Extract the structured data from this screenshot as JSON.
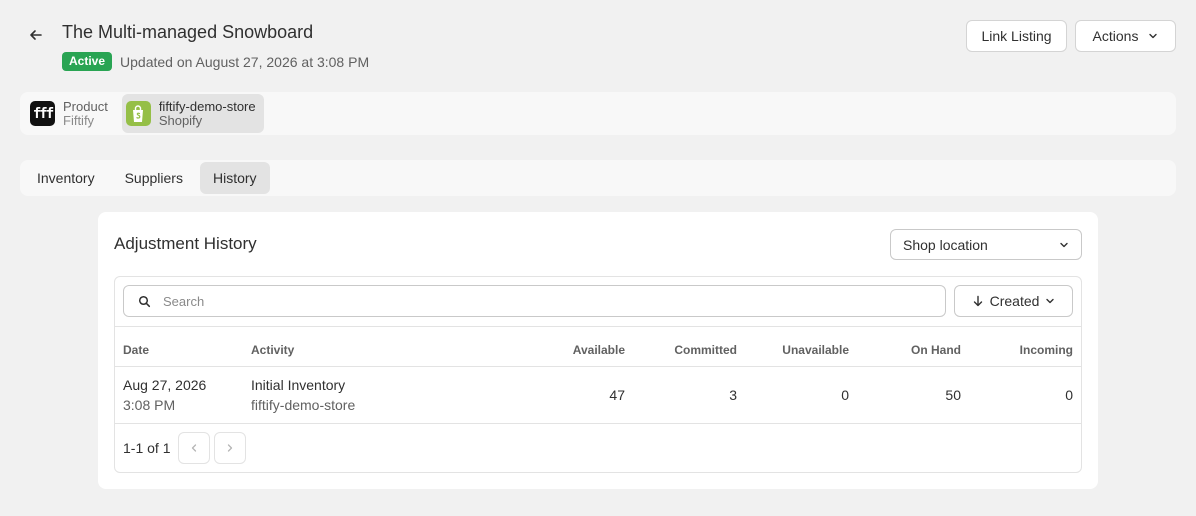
{
  "header": {
    "title": "The Multi-managed Snowboard",
    "status": "Active",
    "updated": "Updated on August 27, 2026 at 3:08 PM",
    "link_listing_label": "Link Listing",
    "actions_label": "Actions"
  },
  "channels": [
    {
      "name": "Product",
      "sub": "Fiftify",
      "logo": "fff"
    },
    {
      "name": "fiftify-demo-store",
      "sub": "Shopify",
      "logo": "shopify-bag"
    }
  ],
  "tabs": [
    {
      "label": "Inventory"
    },
    {
      "label": "Suppliers"
    },
    {
      "label": "History"
    }
  ],
  "card": {
    "title": "Adjustment History",
    "location_select": "Shop location",
    "search_placeholder": "Search",
    "sort_label": "Created",
    "columns": [
      "Date",
      "Activity",
      "Available",
      "Committed",
      "Unavailable",
      "On Hand",
      "Incoming"
    ],
    "rows": [
      {
        "date": "Aug 27, 2026",
        "time": "3:08 PM",
        "activity": "Initial Inventory",
        "store": "fiftify-demo-store",
        "available": "47",
        "committed": "3",
        "unavailable": "0",
        "on_hand": "50",
        "incoming": "0"
      }
    ],
    "pagination": "1-1 of 1"
  },
  "colors": {
    "active_badge": "#29a453",
    "shopify_green": "#95bf47",
    "background": "#f1f1f1"
  }
}
